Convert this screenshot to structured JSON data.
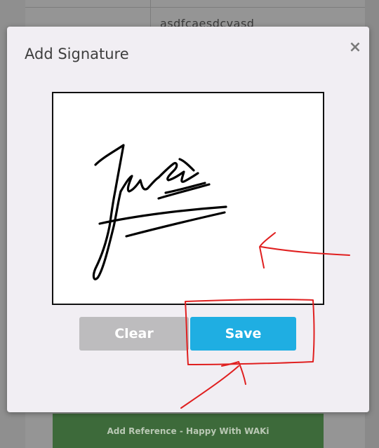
{
  "background": {
    "cell_text": "asdfcaesdcvasd",
    "bottom_button_label": "Add Reference - Happy With WAKi"
  },
  "modal": {
    "title": "Add Signature",
    "close_icon": "×",
    "clear_label": "Clear",
    "save_label": "Save"
  },
  "colors": {
    "save": "#1faee2",
    "clear": "#bdbcbe",
    "annotation": "#e02020"
  }
}
